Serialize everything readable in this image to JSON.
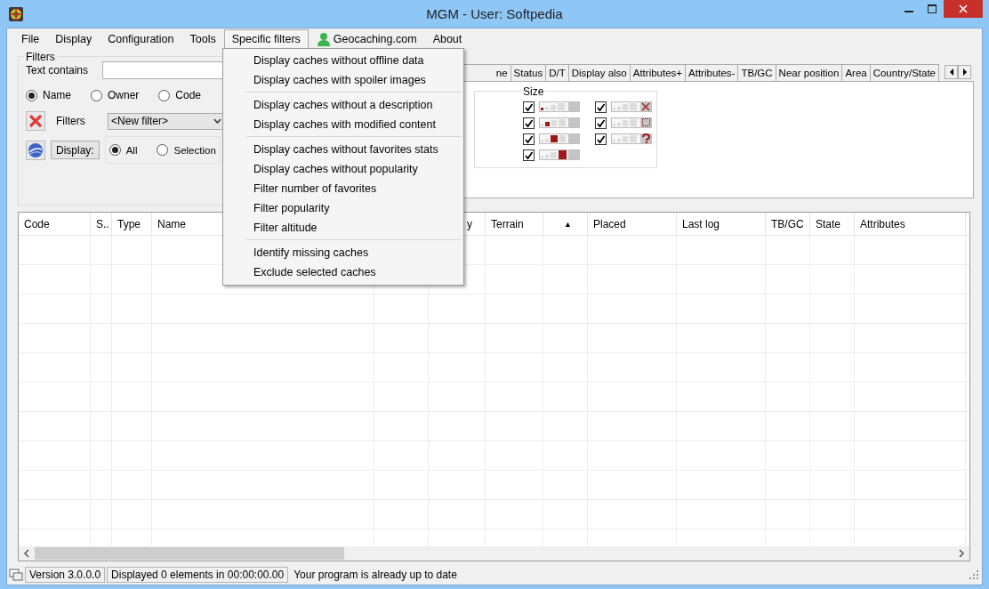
{
  "window": {
    "title": "MGM - User: Softpedia"
  },
  "menu_bar": [
    {
      "label": "File",
      "selected": false,
      "kind": "text"
    },
    {
      "label": "Display",
      "selected": false,
      "kind": "text"
    },
    {
      "label": "Configuration",
      "selected": false,
      "kind": "text"
    },
    {
      "label": "Tools",
      "selected": false,
      "kind": "text"
    },
    {
      "label": "Specific filters",
      "selected": true,
      "kind": "text"
    },
    {
      "label": "Geocaching.com",
      "selected": false,
      "kind": "account"
    },
    {
      "label": "About",
      "selected": false,
      "kind": "text"
    }
  ],
  "filters": {
    "title": "Filters",
    "text_label": "Text contains",
    "search_in": [
      {
        "label": "Name",
        "selected": true
      },
      {
        "label": "Owner",
        "selected": false
      },
      {
        "label": "Code",
        "selected": false
      }
    ],
    "filters_label": "Filters",
    "filter_select": "<New filter>",
    "display_button": "Display:",
    "display_scope": [
      {
        "label": "All",
        "selected": true
      },
      {
        "label": "Selection",
        "selected": false
      }
    ]
  },
  "tabs": [
    {
      "label": "ne",
      "selected": false
    },
    {
      "label": "Status",
      "selected": false
    },
    {
      "label": "D/T",
      "selected": false
    },
    {
      "label": "Display also",
      "selected": false
    },
    {
      "label": "Attributes+",
      "selected": false
    },
    {
      "label": "Attributes-",
      "selected": false
    },
    {
      "label": "TB/GC",
      "selected": false
    },
    {
      "label": "Near position",
      "selected": false
    },
    {
      "label": "Area",
      "selected": false
    },
    {
      "label": "Country/State",
      "selected": false
    }
  ],
  "size_group": {
    "title": "Size",
    "options": [
      {
        "kind": "micro",
        "checked": true
      },
      {
        "kind": "small",
        "checked": true
      },
      {
        "kind": "regular",
        "checked": true
      },
      {
        "kind": "large",
        "checked": true
      },
      {
        "kind": "virtual",
        "checked": true
      },
      {
        "kind": "other",
        "checked": true
      },
      {
        "kind": "unknown",
        "checked": true
      }
    ]
  },
  "menu": {
    "sections": [
      [
        "Display caches without offline data",
        "Display caches with spoiler images"
      ],
      [
        "Display caches without a description",
        "Display caches with modified content"
      ],
      [
        "Display caches without favorites stats",
        "Display caches without popularity",
        "Filter number of favorites",
        "Filter popularity",
        "Filter altitude"
      ],
      [
        "Identify missing caches",
        "Exclude selected caches"
      ]
    ]
  },
  "table": {
    "columns": [
      {
        "label": "Code"
      },
      {
        "label": "S.."
      },
      {
        "label": "Type"
      },
      {
        "label": "Name"
      },
      {},
      {
        "label": "y"
      },
      {
        "label": "Terrain"
      },
      {
        "label": "▲"
      },
      {
        "label": "Placed"
      },
      {
        "label": "Last log"
      },
      {
        "label": "TB/GC"
      },
      {
        "label": "State"
      },
      {
        "label": "Attributes"
      }
    ]
  },
  "status_bar": {
    "version": "Version 3.0.0.0",
    "elapsed": "Displayed 0 elements in 00:00:00.00",
    "message": "Your program is already up to date"
  }
}
